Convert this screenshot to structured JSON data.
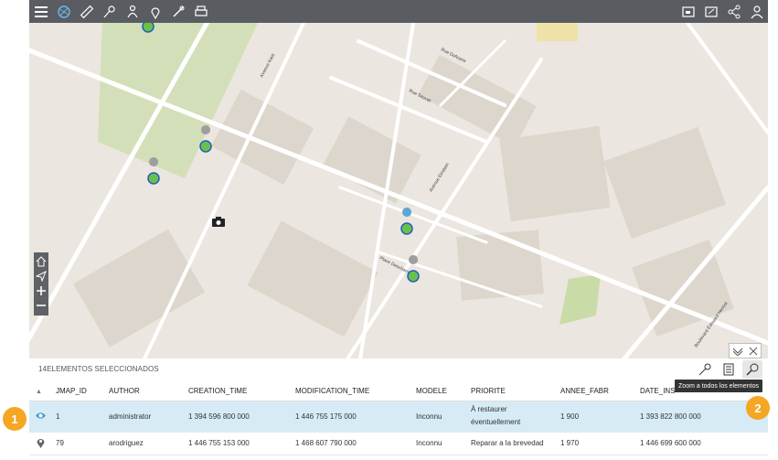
{
  "toolbar": {
    "left_icons": [
      "menu-icon",
      "map-layers-icon",
      "measure-icon",
      "pin-tools-icon",
      "user-location-icon",
      "location-pin-icon",
      "edit-pin-icon",
      "print-icon"
    ],
    "right_icons": [
      "fullscreen-icon",
      "expand-icon",
      "share-icon",
      "user-icon"
    ]
  },
  "map": {
    "street_labels": [
      {
        "text": "Avenue Kant"
      },
      {
        "text": "Rue Dufourre"
      },
      {
        "text": "Rue Sauvet"
      },
      {
        "text": "Avenue Einstein"
      },
      {
        "text": "Place Deschamps"
      },
      {
        "text": "Boulevard Édouard Herriot"
      }
    ],
    "markers": [
      {
        "label": "",
        "color": "#9e9e9e"
      },
      {
        "label": "",
        "color": "#9e9e9e"
      },
      {
        "label": "",
        "color": "#9e9e9e"
      },
      {
        "label": "",
        "color": "#5aa6d8"
      },
      {
        "label": "",
        "color": "#9e9e9e"
      }
    ]
  },
  "panel": {
    "selection_text": "14ELEMENTOS SELECCIONADOS",
    "tooltip": "Zoom a todos los elementos",
    "columns": [
      "",
      "JMAP_ID",
      "AUTHOR",
      "CREATION_TIME",
      "MODIFICATION_TIME",
      "MODELE",
      "PRIORITE",
      "ANNEE_FABR",
      "DATE_INS"
    ],
    "rows": [
      {
        "jmap_id": "1",
        "author": "administrator",
        "creation_time": "1 394 596 800 000",
        "modification_time": "1 446 755 175 000",
        "modele": "Inconnu",
        "priorite": "À restaurer éventuellement",
        "annee_fabr": "1 900",
        "date_ins": "1 393 822 800 000"
      },
      {
        "jmap_id": "79",
        "author": "arodriguez",
        "creation_time": "1 446 755 153 000",
        "modification_time": "1 468 607 790 000",
        "modele": "Inconnu",
        "priorite": "Reparar a la brevedad",
        "annee_fabr": "1 970",
        "date_ins": "1 446 699 600 000"
      }
    ]
  },
  "callouts": [
    "1",
    "2"
  ],
  "colors": {
    "toolbar": "#595d62",
    "selected_row": "#d6ebf5",
    "callout": "#f5a623",
    "marker_green": "#6cc04a",
    "marker_ring": "#1f5fbf"
  }
}
